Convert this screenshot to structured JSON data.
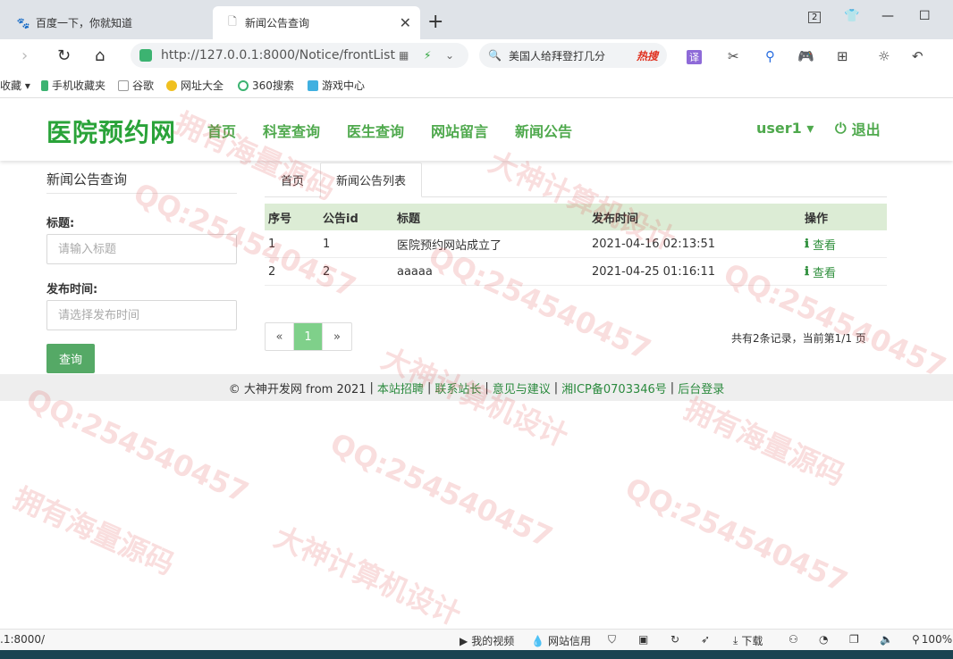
{
  "browser": {
    "tabs": [
      {
        "label": "百度一下，你就知道",
        "active": false
      },
      {
        "label": "新闻公告查询",
        "active": true
      }
    ],
    "tab_count": "2",
    "url": "http://127.0.0.1:8000/Notice/frontList",
    "search_text": "美国人给拜登打几分",
    "search_hot": "热搜",
    "translate_label": "译",
    "bookmarks": [
      "收藏",
      "手机收藏夹",
      "谷歌",
      "网址大全",
      "360搜索",
      "游戏中心"
    ]
  },
  "site": {
    "logo": "医院预约网",
    "nav": [
      "首页",
      "科室查询",
      "医生查询",
      "网站留言",
      "新闻公告"
    ],
    "user": "user1 ▾",
    "logout": "退出"
  },
  "search_panel": {
    "title": "新闻公告查询",
    "title_label": "标题:",
    "title_placeholder": "请输入标题",
    "date_label": "发布时间:",
    "date_placeholder": "请选择发布时间",
    "submit": "查询"
  },
  "content_tabs": [
    "首页",
    "新闻公告列表"
  ],
  "table": {
    "headers": [
      "序号",
      "公告id",
      "标题",
      "发布时间",
      "操作"
    ],
    "rows": [
      {
        "no": "1",
        "id": "1",
        "title": "医院预约网站成立了",
        "time": "2021-04-16 02:13:51",
        "action": "查看"
      },
      {
        "no": "2",
        "id": "2",
        "title": "aaaaa",
        "time": "2021-04-25 01:16:11",
        "action": "查看"
      }
    ]
  },
  "pagination": {
    "prev": "«",
    "current": "1",
    "next": "»",
    "info": "共有2条记录，当前第1/1 页"
  },
  "footer": {
    "copyright": "© 大神开发网 from 2021",
    "links": [
      "本站招聘",
      "联系站长",
      "意见与建议",
      "湘ICP备0703346号",
      "后台登录"
    ]
  },
  "statusbar": {
    "url": ".1:8000/",
    "items": [
      "我的视频",
      "网站信用",
      "下载",
      "100%"
    ]
  },
  "watermark": [
    "QQ:254540457",
    "大神计算机设计",
    "拥有海量源码"
  ],
  "colors": {
    "brand": "#2aa339",
    "nav": "#4fa94d",
    "table_header": "#dcecd5",
    "button": "#55a966",
    "pager_active": "#7fd08a"
  }
}
